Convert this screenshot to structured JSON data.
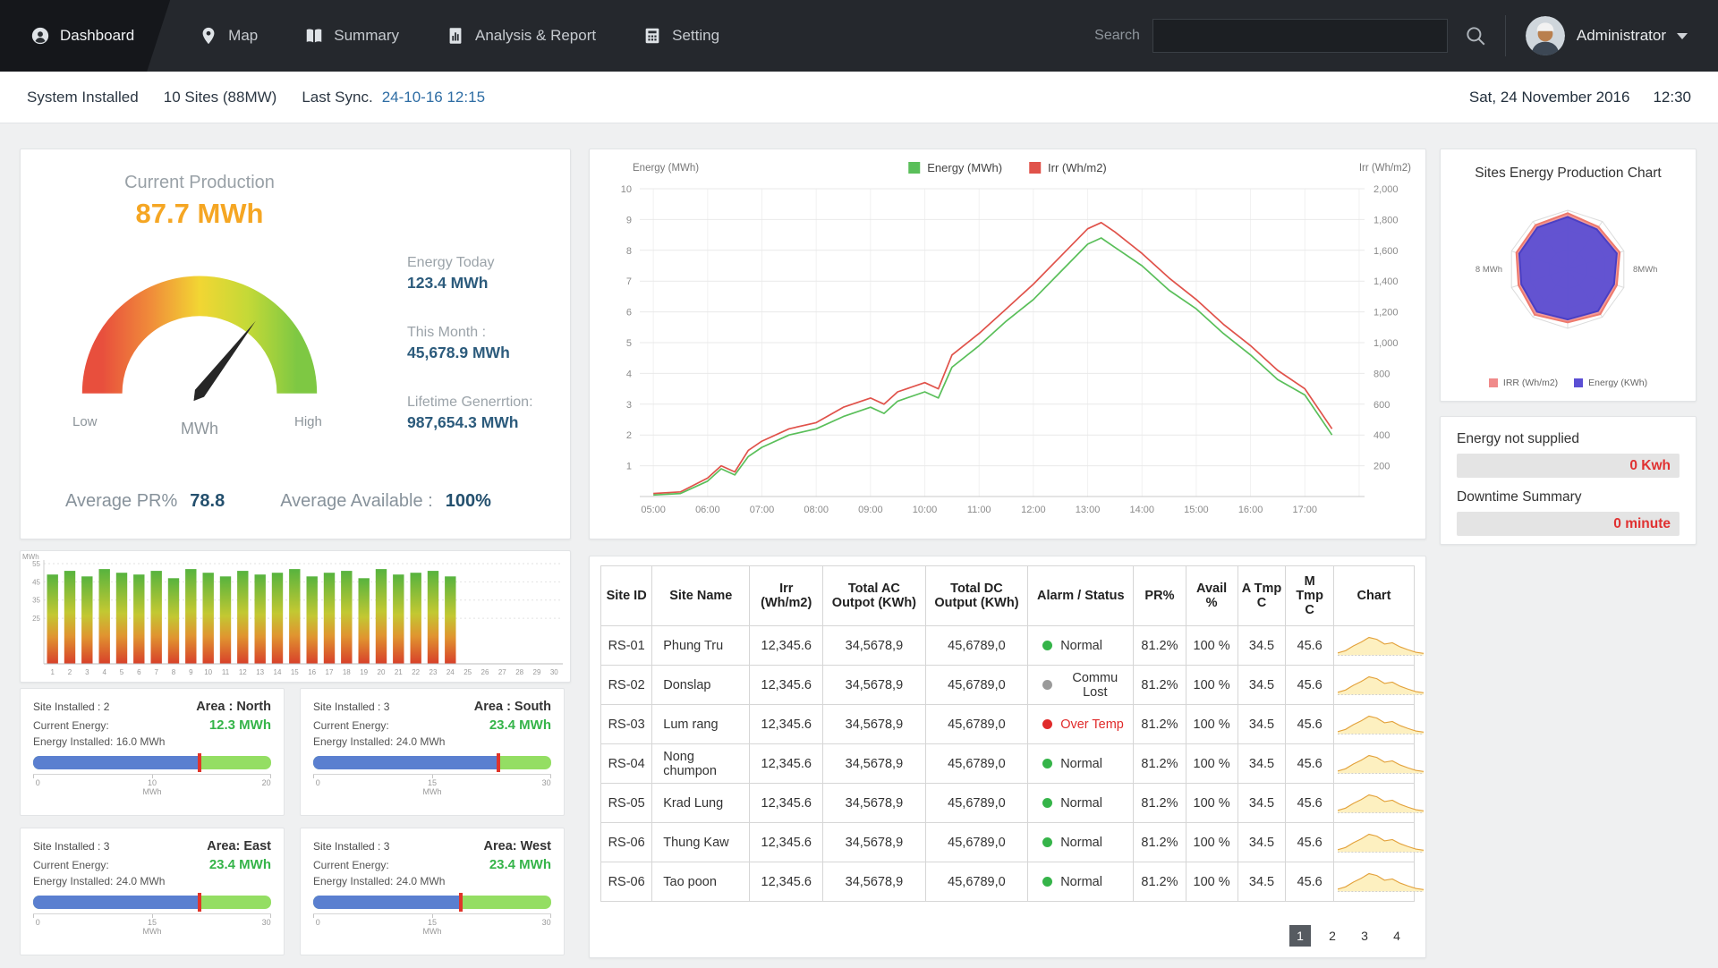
{
  "nav": {
    "items": [
      {
        "label": "Dashboard"
      },
      {
        "label": "Map"
      },
      {
        "label": "Summary"
      },
      {
        "label": "Analysis & Report"
      },
      {
        "label": "Setting"
      }
    ],
    "search_label": "Search",
    "user_name": "Administrator"
  },
  "subheader": {
    "system_label": "System Installed",
    "sites": "10 Sites (88MW)",
    "sync_label": "Last Sync.",
    "sync_value": "24-10-16 12:15",
    "date": "Sat, 24 November 2016",
    "time": "12:30"
  },
  "production": {
    "title": "Current Production",
    "value": "87.7 MWh",
    "gauge": {
      "low": "Low",
      "unit": "MWh",
      "high": "High",
      "fraction": 0.71
    },
    "stats": [
      {
        "label": "Energy Today",
        "value": "123.4 MWh"
      },
      {
        "label": "This Month :",
        "value": "45,678.9 MWh"
      },
      {
        "label": "Lifetime Generrtion:",
        "value": "987,654.3 MWh"
      }
    ],
    "avg_pr_label": "Average PR%",
    "avg_pr_value": "78.8",
    "avg_avail_label": "Average Available :",
    "avg_avail_value": "100%"
  },
  "areas": [
    {
      "sites_label": "Site Installed : 2",
      "area_label": "Area : North",
      "current_label": "Current Energy:",
      "current_value": "12.3 MWh",
      "installed_label": "Energy Installed: 16.0 MWh",
      "scale": [
        "0",
        "10",
        "20"
      ],
      "unit": "MWh",
      "fill": 0.7,
      "marker": 0.7
    },
    {
      "sites_label": "Site Installed : 3",
      "area_label": "Area : South",
      "current_label": "Current Energy:",
      "current_value": "23.4 MWh",
      "installed_label": "Energy Installed: 24.0 MWh",
      "scale": [
        "0",
        "15",
        "30"
      ],
      "unit": "MWh",
      "fill": 0.78,
      "marker": 0.78
    },
    {
      "sites_label": "Site Installed : 3",
      "area_label": "Area: East",
      "current_label": "Current Energy:",
      "current_value": "23.4 MWh",
      "installed_label": "Energy Installed: 24.0 MWh",
      "scale": [
        "0",
        "15",
        "30"
      ],
      "unit": "MWh",
      "fill": 0.7,
      "marker": 0.7
    },
    {
      "sites_label": "Site Installed : 3",
      "area_label": "Area: West",
      "current_label": "Current Energy:",
      "current_value": "23.4 MWh",
      "installed_label": "Energy Installed: 24.0 MWh",
      "scale": [
        "0",
        "15",
        "30"
      ],
      "unit": "MWh",
      "fill": 0.62,
      "marker": 0.62
    }
  ],
  "energy_panel": {
    "not_supplied_label": "Energy not supplied",
    "not_supplied_value": "0 Kwh",
    "downtime_label": "Downtime Summary",
    "downtime_value": "0 minute"
  },
  "table": {
    "columns": [
      "Site ID",
      "Site Name",
      "Irr (Wh/m2)",
      "Total AC Outpot (KWh)",
      "Total DC Output (KWh)",
      "Alarm / Status",
      "PR%",
      "Avail %",
      "A Tmp C",
      "M Tmp C",
      "Chart"
    ],
    "rows": [
      {
        "site_id": "RS-01",
        "site_name": "Phung Tru",
        "irr": "12,345.6",
        "ac": "34,5678,9",
        "dc": "45,6789,0",
        "status": "Normal",
        "status_color": "#35b449",
        "status_text_color": "#333333",
        "pr": "81.2%",
        "avail": "100 %",
        "a_tmp": "34.5",
        "m_tmp": "45.6"
      },
      {
        "site_id": "RS-02",
        "site_name": "Donslap",
        "irr": "12,345.6",
        "ac": "34,5678,9",
        "dc": "45,6789,0",
        "status": "Commu Lost",
        "status_color": "#9a9a9a",
        "status_text_color": "#333333",
        "pr": "81.2%",
        "avail": "100 %",
        "a_tmp": "34.5",
        "m_tmp": "45.6"
      },
      {
        "site_id": "RS-03",
        "site_name": "Lum rang",
        "irr": "12,345.6",
        "ac": "34,5678,9",
        "dc": "45,6789,0",
        "status": "Over Temp",
        "status_color": "#e02b2b",
        "status_text_color": "#e02b2b",
        "pr": "81.2%",
        "avail": "100 %",
        "a_tmp": "34.5",
        "m_tmp": "45.6"
      },
      {
        "site_id": "RS-04",
        "site_name": "Nong chumpon",
        "irr": "12,345.6",
        "ac": "34,5678,9",
        "dc": "45,6789,0",
        "status": "Normal",
        "status_color": "#35b449",
        "status_text_color": "#333333",
        "pr": "81.2%",
        "avail": "100 %",
        "a_tmp": "34.5",
        "m_tmp": "45.6"
      },
      {
        "site_id": "RS-05",
        "site_name": "Krad Lung",
        "irr": "12,345.6",
        "ac": "34,5678,9",
        "dc": "45,6789,0",
        "status": "Normal",
        "status_color": "#35b449",
        "status_text_color": "#333333",
        "pr": "81.2%",
        "avail": "100 %",
        "a_tmp": "34.5",
        "m_tmp": "45.6"
      },
      {
        "site_id": "RS-06",
        "site_name": "Thung Kaw",
        "irr": "12,345.6",
        "ac": "34,5678,9",
        "dc": "45,6789,0",
        "status": "Normal",
        "status_color": "#35b449",
        "status_text_color": "#333333",
        "pr": "81.2%",
        "avail": "100 %",
        "a_tmp": "34.5",
        "m_tmp": "45.6"
      },
      {
        "site_id": "RS-06",
        "site_name": "Tao poon",
        "irr": "12,345.6",
        "ac": "34,5678,9",
        "dc": "45,6789,0",
        "status": "Normal",
        "status_color": "#35b449",
        "status_text_color": "#333333",
        "pr": "81.2%",
        "avail": "100 %",
        "a_tmp": "34.5",
        "m_tmp": "45.6"
      }
    ],
    "pagination": [
      "1",
      "2",
      "3",
      "4"
    ],
    "active_page": "1"
  },
  "chart_data": [
    {
      "id": "energy_irr_line",
      "type": "line",
      "x_hours": [
        5,
        5.5,
        6,
        6.25,
        6.5,
        6.75,
        7,
        7.5,
        8,
        8.5,
        9,
        9.25,
        9.5,
        10,
        10.25,
        10.5,
        11,
        11.5,
        12,
        12.5,
        13,
        13.25,
        13.5,
        14,
        14.5,
        15,
        15.5,
        16,
        16.5,
        17,
        17.5
      ],
      "x_ticks": [
        "05:00",
        "06:00",
        "07:00",
        "08:00",
        "09:00",
        "10:00",
        "11:00",
        "12:00",
        "13:00",
        "14:00",
        "15:00",
        "16:00",
        "17:00"
      ],
      "series": [
        {
          "name": "Energy (MWh)",
          "axis": "left",
          "color": "#5abf5a",
          "values": [
            0.05,
            0.1,
            0.5,
            0.9,
            0.7,
            1.3,
            1.6,
            2.0,
            2.2,
            2.6,
            2.9,
            2.7,
            3.1,
            3.4,
            3.2,
            4.2,
            4.9,
            5.7,
            6.4,
            7.3,
            8.2,
            8.4,
            8.1,
            7.5,
            6.7,
            6.1,
            5.3,
            4.6,
            3.8,
            3.3,
            2.0
          ]
        },
        {
          "name": "Irr (Wh/m2)",
          "axis": "right",
          "color": "#e0524a",
          "values": [
            20,
            30,
            120,
            200,
            160,
            300,
            360,
            440,
            480,
            580,
            640,
            600,
            680,
            740,
            700,
            920,
            1060,
            1220,
            1380,
            1560,
            1740,
            1780,
            1720,
            1580,
            1420,
            1280,
            1120,
            980,
            820,
            700,
            440
          ]
        }
      ],
      "left_axis": {
        "label": "Energy (MWh)",
        "min": 0,
        "max": 10,
        "ticks": [
          1,
          2,
          3,
          4,
          5,
          6,
          7,
          8,
          9,
          10
        ]
      },
      "right_axis": {
        "label": "Irr (Wh/m2)",
        "min": 0,
        "max": 2000,
        "ticks": [
          200,
          400,
          600,
          800,
          1000,
          1200,
          1400,
          1600,
          1800,
          2000
        ]
      },
      "grid": true,
      "legend_position": "top-center"
    },
    {
      "id": "daily_production_bar",
      "type": "bar",
      "unit": "MWh",
      "categories": [
        1,
        2,
        3,
        4,
        5,
        6,
        7,
        8,
        9,
        10,
        11,
        12,
        13,
        14,
        15,
        16,
        17,
        18,
        19,
        20,
        21,
        22,
        23,
        24
      ],
      "values": [
        49,
        51,
        48,
        52,
        50,
        49,
        51,
        47,
        52,
        50,
        48,
        51,
        49,
        50,
        52,
        48,
        50,
        51,
        47,
        52,
        49,
        50,
        51,
        48
      ],
      "x_axis_end": 30,
      "y_ticks": [
        55,
        45,
        35,
        25
      ],
      "ylim": [
        0,
        55
      ]
    },
    {
      "id": "sites_radar",
      "type": "radar",
      "title": "Sites Energy Production Chart",
      "axes_count": 10,
      "max": 8,
      "axis_label_left": "8 MWh",
      "axis_label_right": "8MWh",
      "series": [
        {
          "name": "IRR (Wh/m2)",
          "color": "#f08a8a",
          "values": [
            7.6,
            7.1,
            7.4,
            7.0,
            7.5,
            7.2,
            7.6,
            7.0,
            7.3,
            7.4
          ]
        },
        {
          "name": "Energy (KWh)",
          "color": "#5b4fd4",
          "values": [
            7.1,
            6.7,
            7.0,
            6.6,
            7.0,
            6.8,
            7.1,
            6.6,
            6.9,
            7.0
          ]
        }
      ]
    },
    {
      "id": "row_sparkline",
      "type": "area",
      "color_fill": "#fdf0c0",
      "color_line": "#e3a23c",
      "values": [
        0.08,
        0.2,
        0.45,
        0.65,
        0.9,
        0.8,
        0.55,
        0.62,
        0.4,
        0.25,
        0.12,
        0.06
      ]
    }
  ]
}
